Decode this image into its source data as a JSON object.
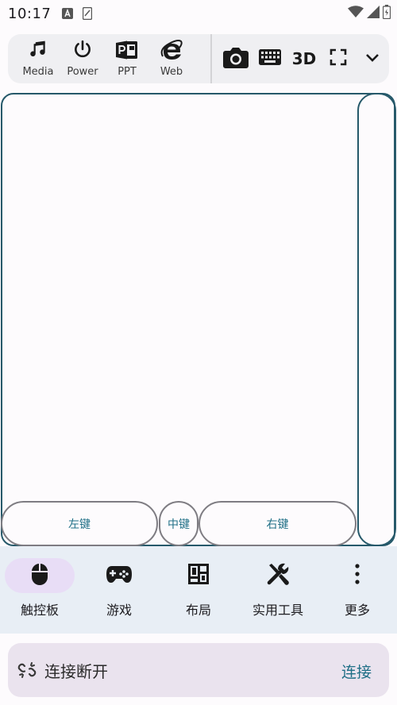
{
  "status_bar": {
    "time": "10:17"
  },
  "toolbar": {
    "left_tools": [
      {
        "label": "Media",
        "icon": "music-note-icon"
      },
      {
        "label": "Power",
        "icon": "power-icon"
      },
      {
        "label": "PPT",
        "icon": "powerpoint-icon"
      },
      {
        "label": "Web",
        "icon": "internet-explorer-icon"
      }
    ],
    "right_tools": [
      {
        "icon": "camera-icon"
      },
      {
        "icon": "keyboard-icon"
      },
      {
        "icon": "3d-icon",
        "text": "3D"
      },
      {
        "icon": "fullscreen-icon"
      },
      {
        "icon": "chevron-down-icon"
      }
    ]
  },
  "touchpad": {
    "left_button": "左键",
    "middle_button": "中键",
    "right_button": "右键"
  },
  "bottom_nav": {
    "items": [
      {
        "label": "触控板",
        "icon": "mouse-icon",
        "active": true
      },
      {
        "label": "游戏",
        "icon": "gamepad-icon",
        "active": false
      },
      {
        "label": "布局",
        "icon": "layout-icon",
        "active": false
      },
      {
        "label": "实用工具",
        "icon": "tools-icon",
        "active": false
      },
      {
        "label": "更多",
        "icon": "more-vertical-icon",
        "active": false
      }
    ]
  },
  "connection": {
    "status": "连接断开",
    "action": "连接",
    "icon": "link-off-icon"
  },
  "colors": {
    "accent": "#26596a",
    "link": "#1f6f86",
    "nav_bg": "#e8eef5",
    "active_pill": "#e8ddf6"
  }
}
